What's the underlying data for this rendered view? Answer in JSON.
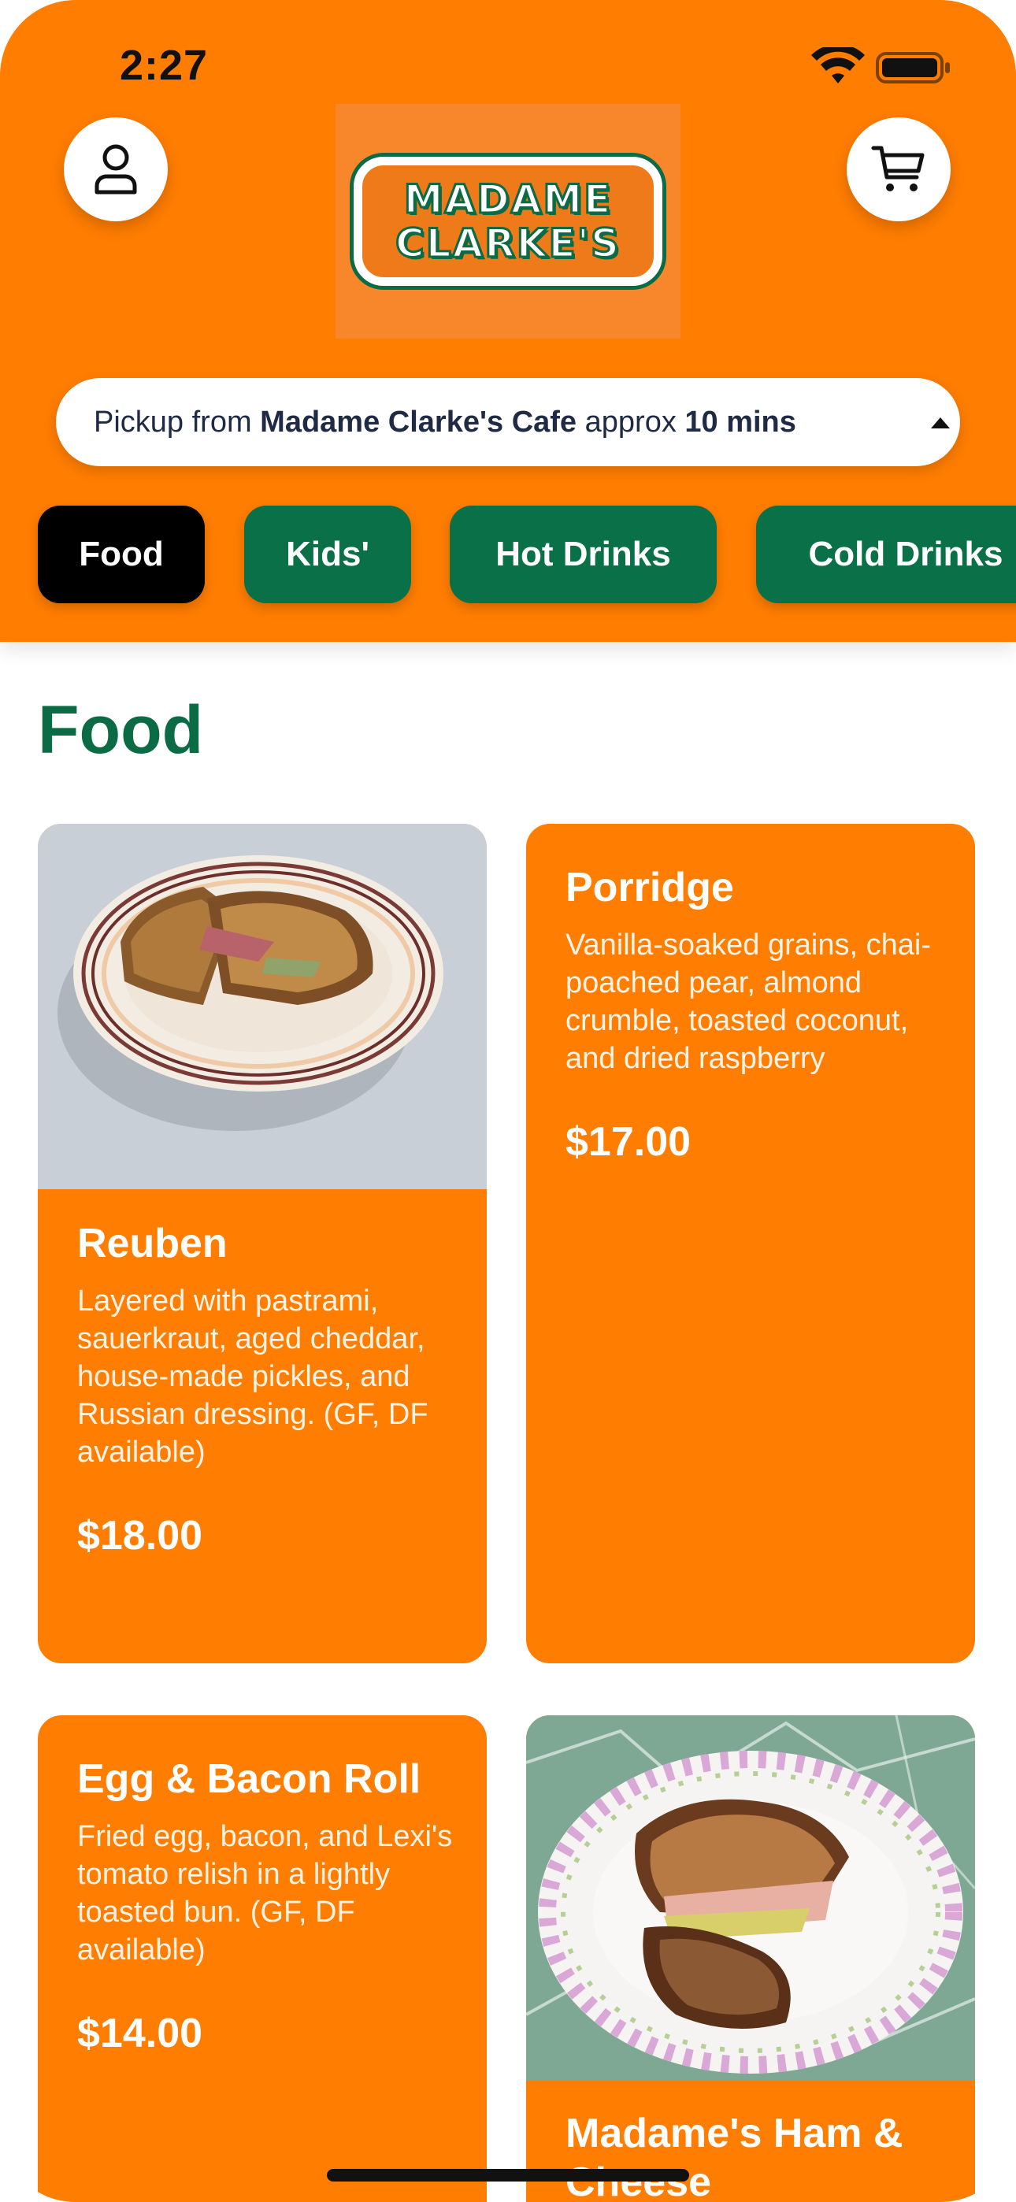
{
  "status_bar": {
    "time": "2:27"
  },
  "header": {
    "logo_line1": "MADAME",
    "logo_line2": "CLARKE'S",
    "pickup": {
      "prefix": "Pickup from ",
      "location": "Madame Clarke's Cafe",
      "middle": " approx ",
      "time": "10 mins"
    }
  },
  "tabs": [
    {
      "label": "Food",
      "active": true
    },
    {
      "label": "Kids'"
    },
    {
      "label": "Hot Drinks"
    },
    {
      "label": "Cold Drinks"
    }
  ],
  "section": {
    "title": "Food"
  },
  "items": [
    {
      "name": "Reuben",
      "description": "Layered with pastrami, sauerkraut,  aged cheddar, house-made pickles,  and Russian dressing. (GF, DF available)",
      "price": "$18.00"
    },
    {
      "name": "Porridge",
      "description": "Vanilla-soaked grains, chai-poached pear, almond crumble, toasted coconut, and dried raspberry",
      "price": "$17.00"
    },
    {
      "name": "Egg & Bacon Roll",
      "description": "Fried egg, bacon, and Lexi's tomato relish in a lightly toasted bun. (GF, DF available)",
      "price": "$14.00"
    },
    {
      "name": "Madame's Ham & Cheese"
    }
  ],
  "colors": {
    "brand_orange": "#ff7d00",
    "brand_green": "#0a7048",
    "active_tab": "#000000"
  },
  "icons": [
    "profile-icon",
    "cart-icon",
    "wifi-icon",
    "battery-icon",
    "caret-up-icon"
  ]
}
